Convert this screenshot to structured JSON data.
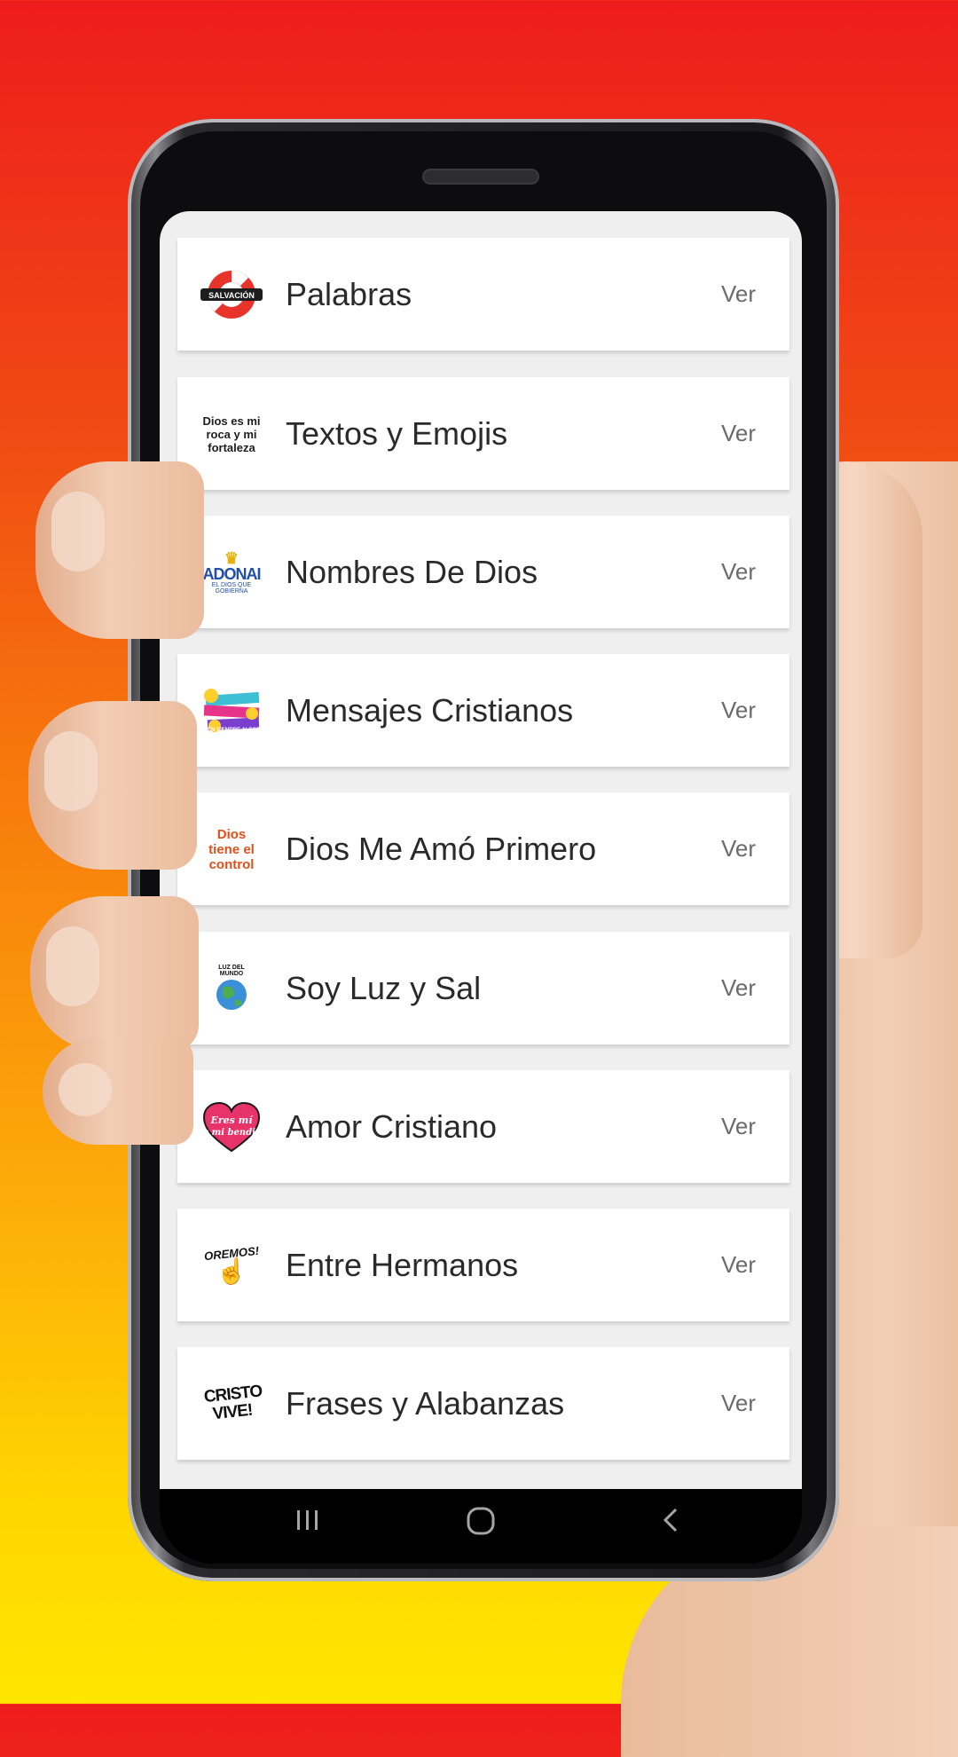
{
  "items": [
    {
      "title": "Palabras",
      "action": "Ver",
      "thumb_text": "SALVACIÓN",
      "thumb_icon": "life-ring-icon"
    },
    {
      "title": "Textos y Emojis",
      "action": "Ver",
      "thumb_text": "Dios es mi roca y mi fortaleza",
      "thumb_icon": "text-sticker-icon"
    },
    {
      "title": "Nombres De Dios",
      "action": "Ver",
      "thumb_text": "ADONAI",
      "thumb_subtext": "EL DIOS QUE GOBIERNA",
      "thumb_icon": "crown-icon"
    },
    {
      "title": "Mensajes Cristianos",
      "action": "Ver",
      "thumb_text": "ESTÉN SIEMPRE ALEGRES",
      "thumb_icon": "emoji-sticker-icon"
    },
    {
      "title": "Dios Me Amó Primero",
      "action": "Ver",
      "thumb_text": "Dios tiene el control",
      "thumb_icon": "gamepad-icon"
    },
    {
      "title": "Soy Luz y Sal",
      "action": "Ver",
      "thumb_text": "LUZ DEL MUNDO",
      "thumb_icon": "globe-icon"
    },
    {
      "title": "Amor Cristiano",
      "action": "Ver",
      "thumb_text": "Eres mi bendición",
      "thumb_icon": "heart-icon"
    },
    {
      "title": "Entre Hermanos",
      "action": "Ver",
      "thumb_text": "OREMOS!",
      "thumb_icon": "praying-hands-icon"
    },
    {
      "title": "Frases y Alabanzas",
      "action": "Ver",
      "thumb_text": "CRISTO VIVE!",
      "thumb_icon": "text-sticker-icon"
    }
  ],
  "navbar": {
    "recents_icon": "recents-icon",
    "home_icon": "home-icon",
    "back_icon": "back-icon"
  },
  "colors": {
    "background_top": "#ee1c1c",
    "background_bottom": "#ffe600",
    "card": "#ffffff",
    "screen": "#efefef"
  }
}
